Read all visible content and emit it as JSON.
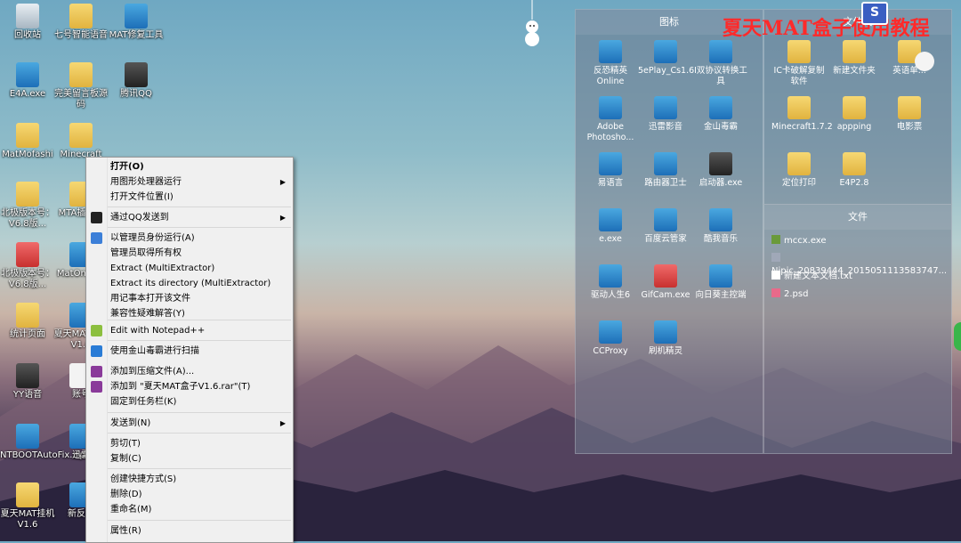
{
  "desktop_icons": [
    {
      "label": "回收站",
      "icon": "recycle-bin-icon"
    },
    {
      "label": "七号智能语音",
      "icon": "folder-icon"
    },
    {
      "label": "MAT修复工具",
      "icon": "tool-icon"
    },
    {
      "label": "E4A.exe",
      "icon": "app-icon"
    },
    {
      "label": "完美留言板源码",
      "icon": "folder-icon"
    },
    {
      "label": "腾讯QQ",
      "icon": "qq-icon"
    },
    {
      "label": "MatMofashi",
      "icon": "folder-icon"
    },
    {
      "label": "Minecraft",
      "icon": "folder-icon"
    },
    {
      "label": "北极版本号：V6.8版...",
      "icon": "folder-icon"
    },
    {
      "label": "MTA插件码",
      "icon": "folder-icon"
    },
    {
      "label": "北极版本号：V6.8版...",
      "icon": "firefox-icon"
    },
    {
      "label": "MatOn...xe",
      "icon": "app-icon"
    },
    {
      "label": "统计页面",
      "icon": "folder-icon"
    },
    {
      "label": "夏天MAT盒子V1.6",
      "icon": "app-icon"
    },
    {
      "label": "YY语音",
      "icon": "yy-icon"
    },
    {
      "label": "账号",
      "icon": "document-icon"
    },
    {
      "label": "NTBOOTAutoFix.zip",
      "icon": "archive-icon"
    },
    {
      "label": "迅雷",
      "icon": "thunder-icon"
    },
    {
      "label": "夏天MAT挂机V1.6",
      "icon": "folder-icon"
    },
    {
      "label": "新反恐",
      "icon": "app-icon"
    }
  ],
  "fence_icons": {
    "title": "图标",
    "items": [
      {
        "label": "反恐精英Online",
        "icon": "cs-icon"
      },
      {
        "label": "5ePlay_Cs1.6",
        "icon": "cs-icon"
      },
      {
        "label": "I双协议转换工具",
        "icon": "tool-icon"
      },
      {
        "label": "Adobe Photosho...",
        "icon": "photoshop-icon"
      },
      {
        "label": "迅雷影音",
        "icon": "player-icon"
      },
      {
        "label": "金山毒霸",
        "icon": "shield-icon"
      },
      {
        "label": "易语言",
        "icon": "app-icon"
      },
      {
        "label": "路由器卫士",
        "icon": "router-icon"
      },
      {
        "label": "启动器.exe",
        "icon": "launcher-icon"
      },
      {
        "label": "e.exe",
        "icon": "app-icon"
      },
      {
        "label": "百度云管家",
        "icon": "cloud-icon"
      },
      {
        "label": "酷我音乐",
        "icon": "music-icon"
      },
      {
        "label": "驱动人生6",
        "icon": "driver-icon"
      },
      {
        "label": "GifCam.exe",
        "icon": "camera-icon"
      },
      {
        "label": "向日葵主控端",
        "icon": "sunflower-icon"
      },
      {
        "label": "CCProxy",
        "icon": "proxy-icon"
      },
      {
        "label": "刷机精灵",
        "icon": "flash-icon"
      }
    ]
  },
  "fence_folders": {
    "title": "文件夹",
    "items": [
      {
        "label": "IC卡破解复制软件",
        "icon": "folder-icon"
      },
      {
        "label": "新建文件夹",
        "icon": "folder-icon"
      },
      {
        "label": "英语单...",
        "icon": "folder-icon"
      },
      {
        "label": "Minecraft1.7.2",
        "icon": "folder-icon"
      },
      {
        "label": "appping",
        "icon": "folder-icon"
      },
      {
        "label": "电影票",
        "icon": "folder-icon"
      },
      {
        "label": "定位打印",
        "icon": "folder-icon"
      },
      {
        "label": "E4P2.8",
        "icon": "folder-icon"
      }
    ]
  },
  "fence_files": {
    "title": "文件",
    "items": [
      {
        "label": "mccx.exe"
      },
      {
        "label": "Nipic_20839444_2015051113583747..."
      },
      {
        "label": "新建文本文档.txt"
      },
      {
        "label": "2.psd"
      }
    ]
  },
  "watermark": "夏天MAT盒子使用教程",
  "context_menu": [
    {
      "label": "打开(O)",
      "bold": true,
      "sub": false
    },
    {
      "label": "用图形处理器运行",
      "sub": true
    },
    {
      "label": "打开文件位置(I)",
      "sub": false
    },
    {
      "label": "通过QQ发送到",
      "sub": true
    },
    {
      "label": "以管理员身份运行(A)",
      "sub": false
    },
    {
      "label": "管理员取得所有权",
      "sub": false
    },
    {
      "label": "Extract (MultiExtractor)",
      "sub": false
    },
    {
      "label": "Extract its directory (MultiExtractor)",
      "sub": false
    },
    {
      "label": "用记事本打开该文件",
      "sub": false
    },
    {
      "label": "兼容性疑难解答(Y)",
      "sub": false
    },
    {
      "label": "Edit with Notepad++",
      "sub": false
    },
    {
      "label": "使用金山毒霸进行扫描",
      "sub": false
    },
    {
      "label": "添加到压缩文件(A)...",
      "sub": false
    },
    {
      "label": "添加到 \"夏天MAT盒子V1.6.rar\"(T)",
      "sub": false
    },
    {
      "label": "固定到任务栏(K)",
      "sub": false
    },
    {
      "label": "发送到(N)",
      "sub": true
    },
    {
      "label": "剪切(T)",
      "sub": false
    },
    {
      "label": "复制(C)",
      "sub": false
    },
    {
      "label": "创建快捷方式(S)",
      "sub": false
    },
    {
      "label": "删除(D)",
      "sub": false
    },
    {
      "label": "重命名(M)",
      "sub": false
    },
    {
      "label": "属性(R)",
      "sub": false
    }
  ],
  "arrow": "▶"
}
